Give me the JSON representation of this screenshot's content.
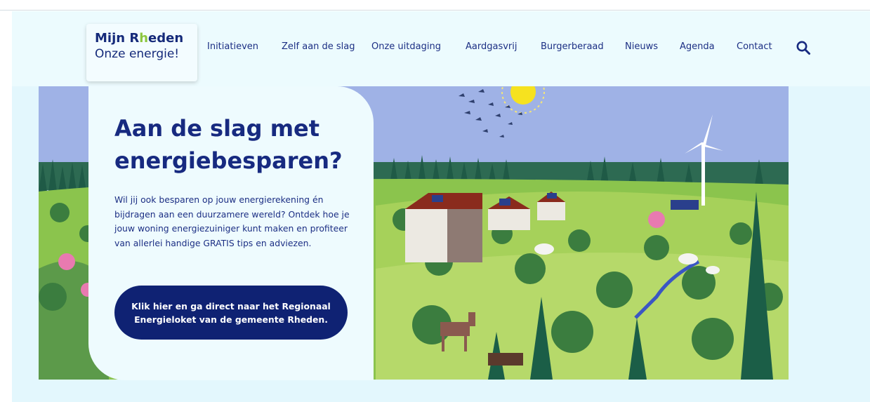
{
  "logo": {
    "line1_pre": "Mijn R",
    "line1_accent": "h",
    "line1_post": "eden",
    "line2": "Onze energie!"
  },
  "nav": {
    "items": [
      "Initiatieven",
      "Zelf aan de slag",
      "Onze uitdaging",
      "Aardgasvrij",
      "Burgerberaad",
      "Nieuws",
      "Agenda",
      "Contact"
    ],
    "search_icon": "search-icon"
  },
  "hero": {
    "title": "Aan de slag met energiebesparen?",
    "body": "Wil jij ook besparen op jouw energierekening én bijdragen aan een duurzamere wereld? Ontdek hoe je jouw woning energiezuiniger kunt maken en profiteer van allerlei handige GRATIS tips en adviezen.",
    "cta": "Klik hier en ga direct naar het Regionaal Energieloket van de gemeente Rheden."
  },
  "colors": {
    "navy": "#172a80",
    "brand_green": "#8cc63f",
    "cta_bg": "#0f2273",
    "page_bg": "#e3f7fd",
    "sky": "#9fb2e6"
  }
}
